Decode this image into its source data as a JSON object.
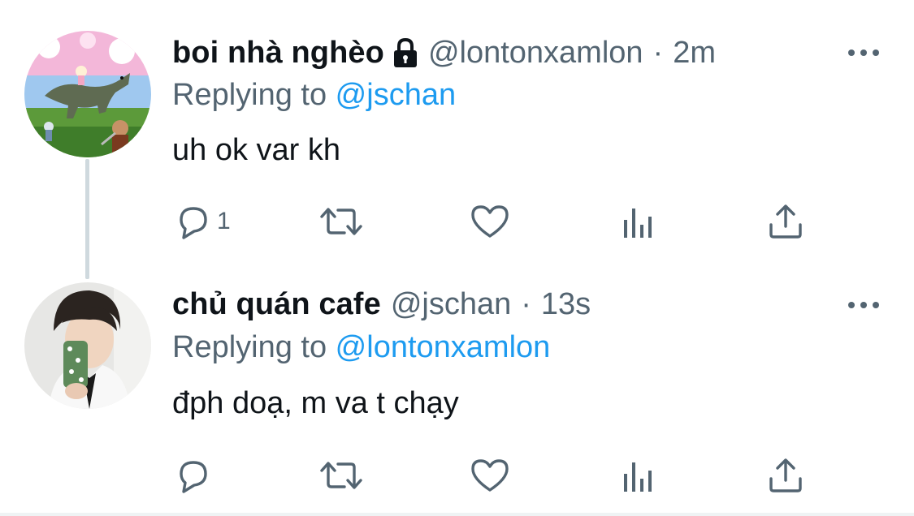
{
  "tweets": [
    {
      "display_name": "boi nhà nghèo",
      "handle": "@lontonxamlon",
      "separator": "·",
      "time": "2m",
      "replying_prefix": "Replying to ",
      "replying_to": "@jschan",
      "text": "uh ok var kh",
      "reply_count": "1",
      "protected": true,
      "avatar_icon": "dinosaur-collage-avatar"
    },
    {
      "display_name": "chủ quán cafe",
      "handle": "@jschan",
      "separator": "·",
      "time": "13s",
      "replying_prefix": "Replying to ",
      "replying_to": "@lontonxamlon",
      "text": "đph doạ, m va t chạy",
      "reply_count": "",
      "protected": false,
      "avatar_icon": "mirror-selfie-avatar"
    }
  ],
  "icons": {
    "reply": "reply-icon",
    "retweet": "retweet-icon",
    "like": "like-icon",
    "views": "analytics-icon",
    "share": "share-icon",
    "more": "more-icon",
    "lock": "lock-icon"
  },
  "colors": {
    "text": "#0f1419",
    "secondary": "#536471",
    "link": "#1d9bf0",
    "thread_line": "#cfd9de"
  }
}
